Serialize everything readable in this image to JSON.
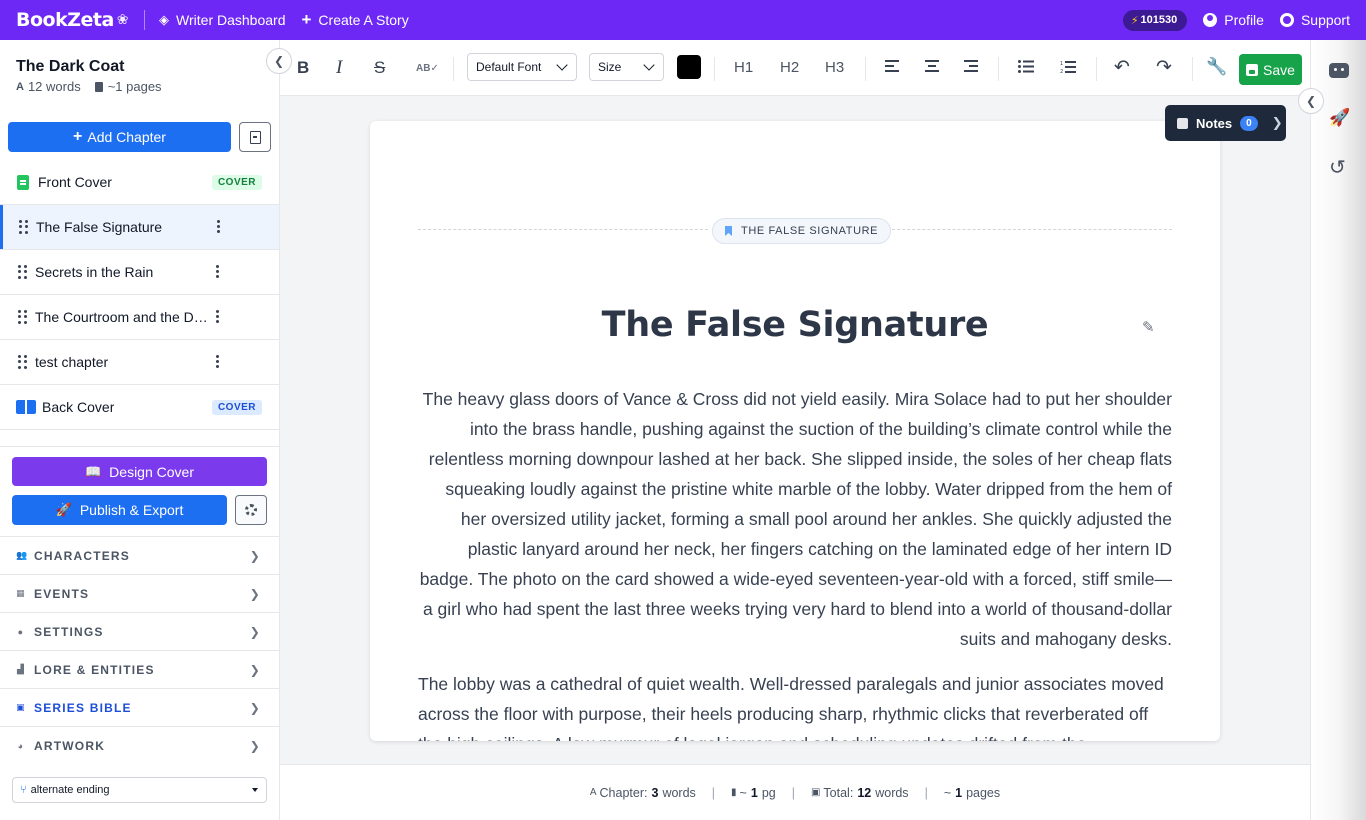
{
  "topbar": {
    "brand": "BookZeta",
    "writer_dashboard": "Writer Dashboard",
    "create_story": "Create A Story",
    "credits": "101530",
    "profile": "Profile",
    "support": "Support"
  },
  "sidebar": {
    "book_title": "The Dark Coat",
    "word_count": "12 words",
    "page_count": "~1 pages",
    "add_chapter": "Add Chapter",
    "chapters": [
      {
        "label": "Front Cover",
        "badge": "COVER"
      },
      {
        "label": "The False Signature"
      },
      {
        "label": "Secrets in the Rain"
      },
      {
        "label": "The Courtroom and the Dark Coat"
      },
      {
        "label": "test chapter"
      },
      {
        "label": "Back Cover",
        "badge": "COVER"
      }
    ],
    "design_cover": "Design Cover",
    "publish_export": "Publish & Export",
    "sections": [
      {
        "label": "CHARACTERS"
      },
      {
        "label": "EVENTS"
      },
      {
        "label": "SETTINGS"
      },
      {
        "label": "LORE & ENTITIES"
      },
      {
        "label": "SERIES BIBLE"
      },
      {
        "label": "ARTWORK"
      }
    ],
    "branch": "alternate ending"
  },
  "toolbar": {
    "font": "Default Font",
    "size": "Size",
    "text_color": "#000000",
    "h1": "H1",
    "h2": "H2",
    "h3": "H3",
    "save": "Save"
  },
  "notes": {
    "label": "Notes",
    "count": "0"
  },
  "editor": {
    "chapter_chip": "THE FALSE SIGNATURE",
    "title": "The False Signature",
    "paragraphs": [
      "The heavy glass doors of Vance & Cross did not yield easily. Mira Solace had to put her shoulder into the brass handle, pushing against the suction of the building’s climate control while the relentless morning downpour lashed at her back. She slipped inside, the soles of her cheap flats squeaking loudly against the pristine white marble of the lobby. Water dripped from the hem of her oversized utility jacket, forming a small pool around her ankles. She quickly adjusted the plastic lanyard around her neck, her fingers catching on the laminated edge of her intern ID badge. The photo on the card showed a wide-eyed seventeen-year-old with a forced, stiff smile—a girl who had spent the last three weeks trying very hard to blend into a world of thousand-dollar suits and mahogany desks.",
      "The lobby was a cathedral of quiet wealth. Well-dressed paralegals and junior associates moved across the floor with purpose, their heels producing sharp, rhythmic clicks that reverberated off the high ceilings. A low murmur of legal jargon and scheduling updates drifted from the"
    ]
  },
  "footer": {
    "chapter_label": "Chapter:",
    "chapter_words": "3",
    "words": "words",
    "chapter_pages_prefix": "~",
    "chapter_pages": "1",
    "pg": "pg",
    "total_label": "Total:",
    "total_words": "12",
    "total_pages_prefix": "~",
    "total_pages": "1",
    "pages": "pages"
  }
}
